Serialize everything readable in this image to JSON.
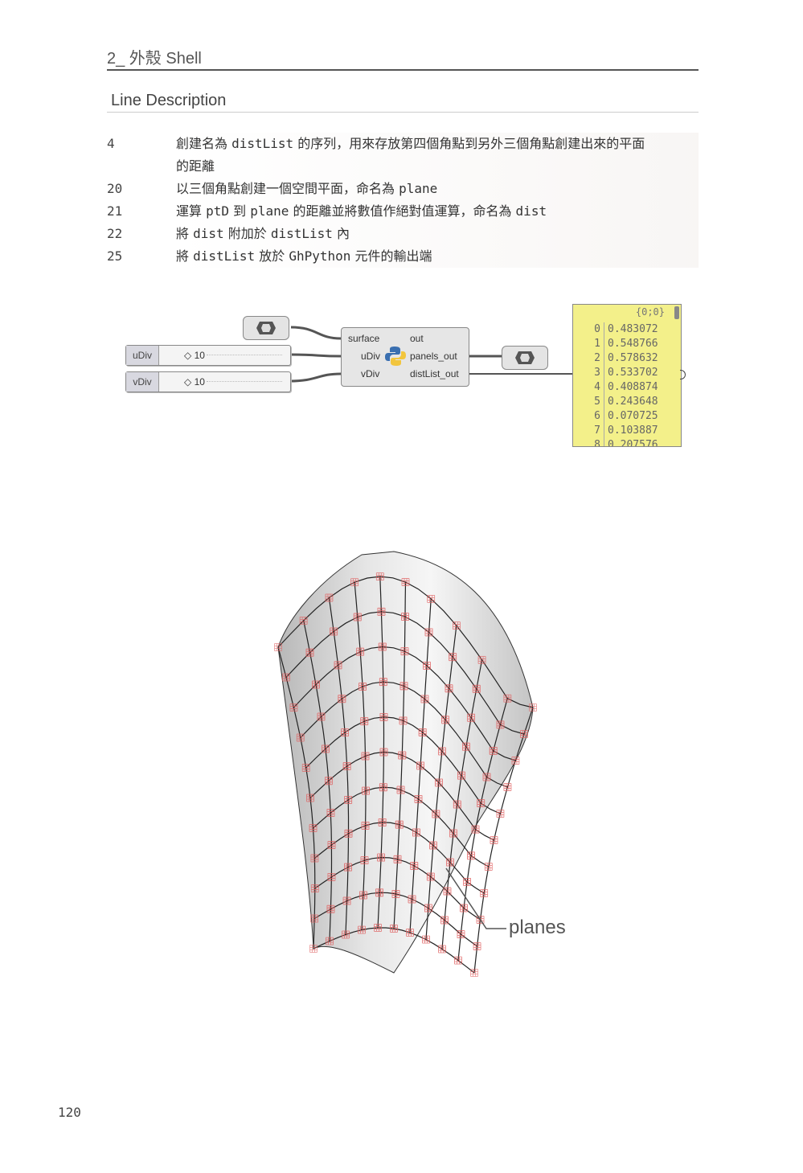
{
  "header": {
    "chapter": "2_ 外殼 Shell",
    "section_title": "Line Description"
  },
  "lines": [
    {
      "num": "4",
      "text_lines": [
        "創建名為 distList 的序列，用來存放第四個角點到另外三個角點創建出來的平面",
        "的距離"
      ]
    },
    {
      "num": "20",
      "text_lines": [
        "以三個角點創建一個空間平面，命名為 plane"
      ]
    },
    {
      "num": "21",
      "text_lines": [
        "運算 ptD 到 plane 的距離並將數值作絕對值運算，命名為 dist"
      ]
    },
    {
      "num": "22",
      "text_lines": [
        "將 dist 附加於 distList 內"
      ]
    },
    {
      "num": "25",
      "text_lines": [
        "將 distList 放於 GhPython 元件的輸出端"
      ]
    }
  ],
  "grasshopper": {
    "sliders": [
      {
        "label": "uDiv",
        "value": "◇ 10"
      },
      {
        "label": "vDiv",
        "value": "◇ 10"
      }
    ],
    "node": {
      "inputs": [
        "surface",
        "uDiv",
        "vDiv"
      ],
      "outputs": [
        "out",
        "panels_out",
        "distList_out"
      ]
    },
    "panel": {
      "header": "{0;0}",
      "items": [
        {
          "i": "0",
          "v": "0.483072"
        },
        {
          "i": "1",
          "v": "0.548766"
        },
        {
          "i": "2",
          "v": "0.578632"
        },
        {
          "i": "3",
          "v": "0.533702"
        },
        {
          "i": "4",
          "v": "0.408874"
        },
        {
          "i": "5",
          "v": "0.243648"
        },
        {
          "i": "6",
          "v": "0.070725"
        },
        {
          "i": "7",
          "v": "0.103887"
        },
        {
          "i": "8",
          "v": "0.207576"
        }
      ]
    }
  },
  "figure": {
    "callout": "planes"
  },
  "page_number": "120",
  "colors": {
    "panel_bg": "#f3f08a",
    "plane_marks": "#e06060"
  }
}
